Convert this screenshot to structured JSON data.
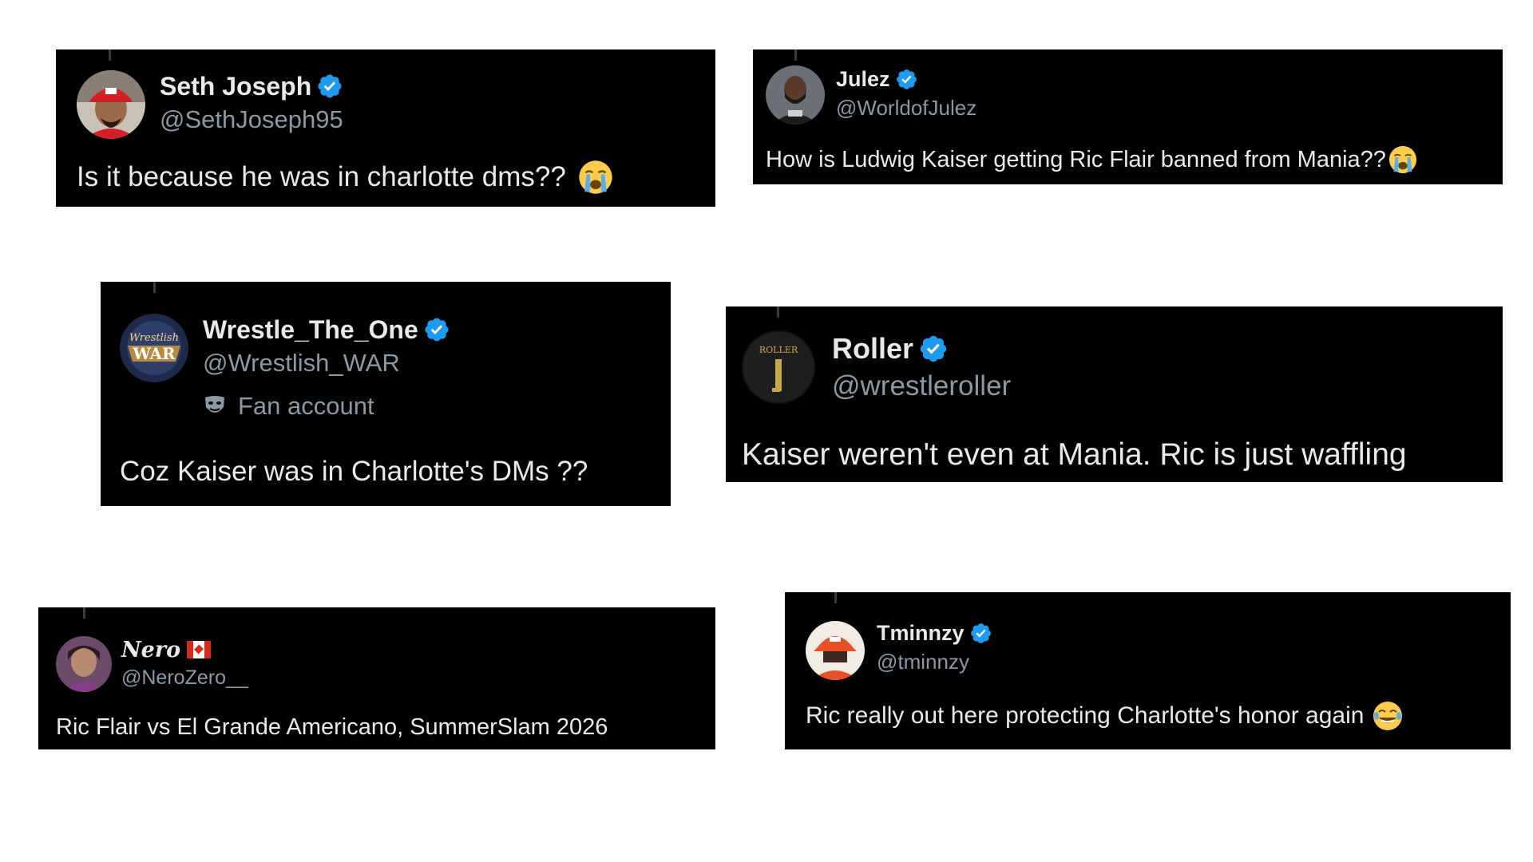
{
  "colors": {
    "card_bg": "#000000",
    "page_bg": "#ffffff",
    "text_primary": "#e7e9ea",
    "text_secondary": "#8b98a5",
    "verified_blue": "#1d9bf0"
  },
  "tweets": [
    {
      "name": "Seth Joseph",
      "handle": "@SethJoseph95",
      "verified": true,
      "text": "Is it because he was in charlotte dms??",
      "emoji": "loudly-crying-face",
      "avatar": "red-cap-man-avatar"
    },
    {
      "name": "Julez",
      "handle": "@WorldofJulez",
      "verified": true,
      "text": "How is Ludwig Kaiser getting Ric Flair banned from Mania??",
      "emoji": "loudly-crying-face",
      "avatar": "bearded-man-avatar"
    },
    {
      "name": "Wrestle_The_One",
      "handle": "@Wrestlish_WAR",
      "verified": true,
      "label": "Fan account",
      "label_icon": "theater-mask-icon",
      "text": "Coz Kaiser was in Charlotte's DMs ??",
      "avatar": "wrestlish-war-logo",
      "avatar_text": "Wrestlish WAR"
    },
    {
      "name": "Roller",
      "handle": "@wrestleroller",
      "verified": true,
      "text": "Kaiser weren't even at Mania. Ric is just waffling",
      "avatar": "roller-logo",
      "avatar_text": "ROLLER"
    },
    {
      "name": "Nero",
      "handle": "@NeroZero__",
      "verified": false,
      "flag": "canada-flag",
      "text": "Ric Flair vs El Grande Americano, SummerSlam 2026",
      "avatar": "anime-character-avatar"
    },
    {
      "name": "Tminnzy",
      "handle": "@tminnzy",
      "verified": true,
      "text": "Ric really out here protecting Charlotte's honor again",
      "emoji": "face-with-tears-of-joy",
      "avatar": "orange-cap-avatar"
    }
  ]
}
